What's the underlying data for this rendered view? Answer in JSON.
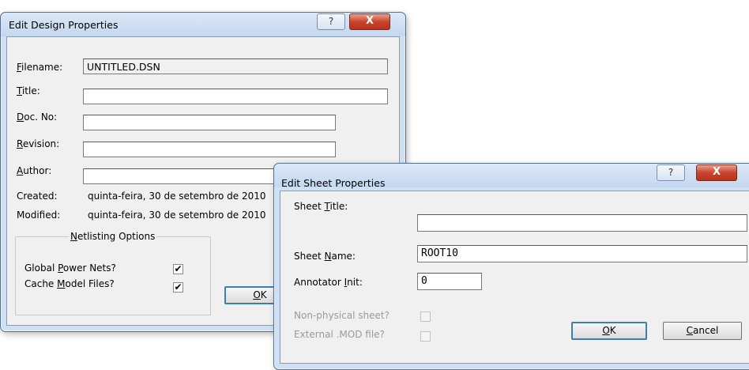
{
  "design": {
    "title": "Edit Design Properties",
    "help": "?",
    "close": "X",
    "filename_label": "Filename:",
    "filename_value": "UNTITLED.DSN",
    "title_label": "Title:",
    "title_value": "",
    "docno_label": "Doc. No:",
    "docno_value": "",
    "revision_label": "Revision:",
    "revision_value": "",
    "author_label": "Author:",
    "author_value": "",
    "created_label": "Created:",
    "created_value": "quinta-feira, 30 de setembro de 2010",
    "modified_label": "Modified:",
    "modified_value": "quinta-feira, 30 de setembro de 2010",
    "netlisting_title": "Netlisting Options",
    "global_power_label": "Global Power Nets?",
    "cache_model_label": "Cache Model Files?",
    "check_mark": "✔",
    "ok_label": "OK"
  },
  "sheet": {
    "title": "Edit Sheet Properties",
    "help": "?",
    "close": "X",
    "sheet_title_label": "Sheet Title:",
    "sheet_title_value": "",
    "sheet_name_label": "Sheet Name:",
    "sheet_name_value": "ROOT10",
    "annotator_label": "Annotator Init:",
    "annotator_value": "0",
    "nonphysical_label": "Non-physical sheet?",
    "external_mod_label": "External .MOD file?",
    "ok_label": "OK",
    "cancel_label": "Cancel"
  }
}
